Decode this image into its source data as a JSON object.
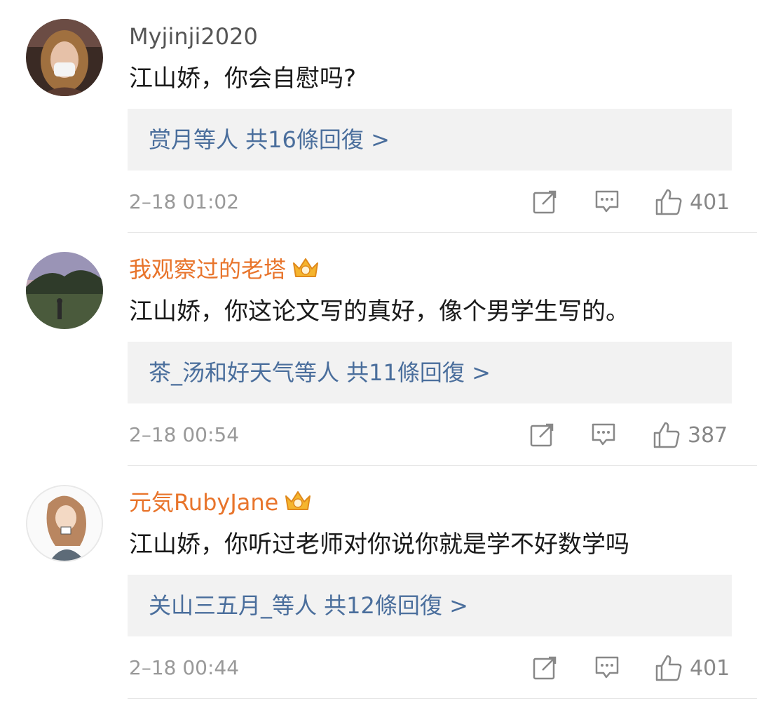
{
  "comments": [
    {
      "username": "Myjinji2020",
      "vip": false,
      "text": "江山娇，你会自慰吗?",
      "replies": "赏月等人 共16條回復 >",
      "time": "2–18 01:02",
      "likes": "401"
    },
    {
      "username": "我观察过的老塔",
      "vip": true,
      "text": "江山娇，你这论文写的真好，像个男学生写的。",
      "replies": "茶_汤和好天气等人 共11條回復 >",
      "time": "2–18 00:54",
      "likes": "387"
    },
    {
      "username": "元気RubyJane",
      "vip": true,
      "text": "江山娇，你听过老师对你说你就是学不好数学吗",
      "replies": "关山三五月_等人 共12條回復 >",
      "time": "2–18 00:44",
      "likes": "401"
    }
  ],
  "icons": {
    "share": "share-icon",
    "comment": "comment-icon",
    "like": "thumbs-up-icon",
    "crown": "vip-crown-icon"
  },
  "colors": {
    "username_vip": "#e8742b",
    "reply_link": "#4a6e9c",
    "reply_bg": "#f2f2f2",
    "meta": "#999999"
  }
}
